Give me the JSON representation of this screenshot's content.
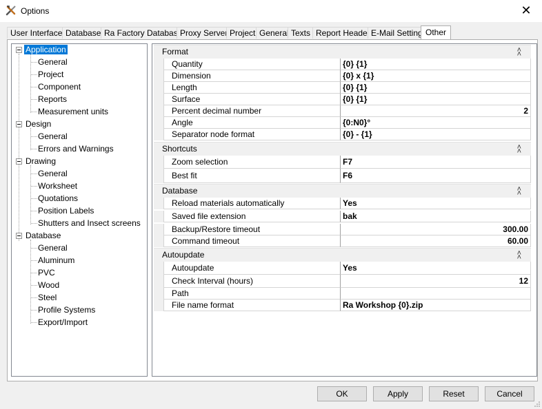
{
  "window": {
    "title": "Options",
    "close": "✕"
  },
  "tabs": [
    "User Interface",
    "Database",
    "Ra Factory Database",
    "Proxy Server",
    "Project",
    "General",
    "Texts",
    "Report Header",
    "E-Mail Settings",
    "Other"
  ],
  "active_tab": "Other",
  "tree": {
    "application": {
      "label": "Application",
      "children": [
        "General",
        "Project",
        "Component",
        "Reports",
        "Measurement units"
      ]
    },
    "design": {
      "label": "Design",
      "children": [
        "General",
        "Errors and Warnings"
      ]
    },
    "drawing": {
      "label": "Drawing",
      "children": [
        "General",
        "Worksheet",
        "Quotations",
        "Position Labels",
        "Shutters and Insect screens"
      ]
    },
    "database": {
      "label": "Database",
      "children": [
        "General",
        "Aluminum",
        "PVC",
        "Wood",
        "Steel",
        "Profile Systems",
        "Export/Import"
      ]
    }
  },
  "properties": {
    "format": {
      "label": "Format",
      "rows": [
        {
          "name": "Quantity",
          "value": "{0} {1}"
        },
        {
          "name": "Dimension",
          "value": "{0} x {1}"
        },
        {
          "name": "Length",
          "value": "{0} {1}"
        },
        {
          "name": "Surface",
          "value": "{0} {1}"
        },
        {
          "name": "Percent decimal number",
          "value": "2"
        },
        {
          "name": "Angle",
          "value": "{0:N0}°"
        },
        {
          "name": "Separator node format",
          "value": "{0} - {1}"
        }
      ]
    },
    "shortcuts": {
      "label": "Shortcuts",
      "rows": [
        {
          "name": "Zoom selection",
          "value": "F7"
        },
        {
          "name": "Best fit",
          "value": "F6"
        }
      ]
    },
    "database": {
      "label": "Database",
      "rows": [
        {
          "name": "Reload materials automatically",
          "value": "Yes"
        },
        {
          "name": "Saved file extension",
          "value": "bak"
        },
        {
          "name": "Backup/Restore timeout",
          "value": "300.00"
        },
        {
          "name": "Command timeout",
          "value": "60.00"
        }
      ]
    },
    "autoupdate": {
      "label": "Autoupdate",
      "rows": [
        {
          "name": "Autoupdate",
          "value": "Yes"
        },
        {
          "name": "Check Interval (hours)",
          "value": "12"
        },
        {
          "name": "Path",
          "value": ""
        },
        {
          "name": "File name format",
          "value": "Ra Workshop {0}.zip"
        }
      ]
    }
  },
  "buttons": {
    "ok": "OK",
    "apply": "Apply",
    "reset": "Reset",
    "cancel": "Cancel"
  },
  "colors": {
    "selection": "#0078d7",
    "window_bg": "#f0f0f0",
    "category_bg": "#f0f0f0"
  },
  "icons": {
    "app": "tools-icon",
    "collapse": "double-chevron-up-icon",
    "expander": "minus-box-icon"
  }
}
